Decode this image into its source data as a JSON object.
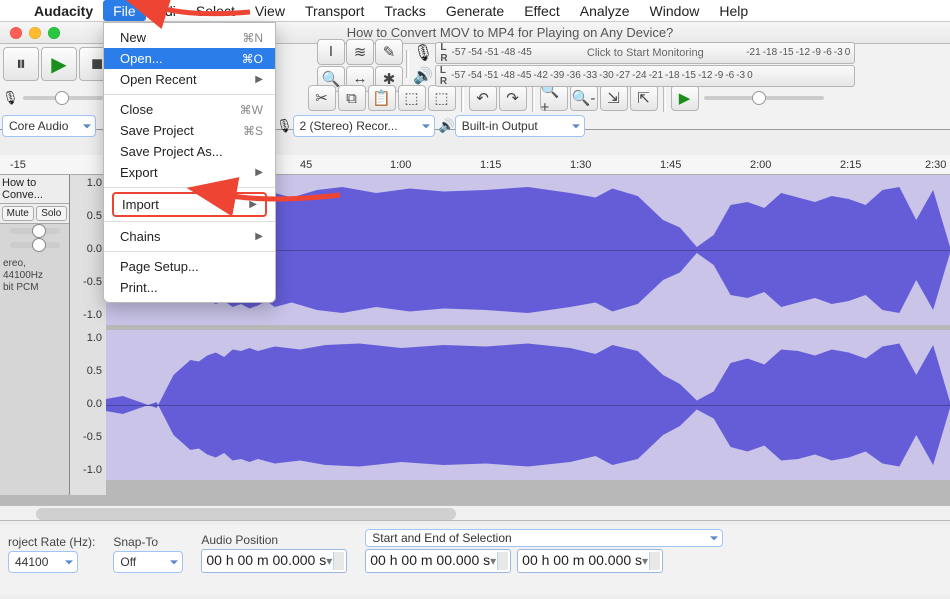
{
  "menubar": {
    "app": "Audacity",
    "items": {
      "file": "File",
      "edit": "Edi",
      "select": "Select",
      "view": "View",
      "transport": "Transport",
      "tracks": "Tracks",
      "generate": "Generate",
      "effect": "Effect",
      "analyze": "Analyze",
      "window": "Window",
      "help": "Help"
    }
  },
  "window": {
    "title": "How to Convert MOV to MP4 for Playing on Any Device?"
  },
  "fileMenu": {
    "new": "New",
    "new_sc": "⌘N",
    "open": "Open...",
    "open_sc": "⌘O",
    "openRecent": "Open Recent",
    "close": "Close",
    "close_sc": "⌘W",
    "saveProject": "Save Project",
    "save_sc": "⌘S",
    "saveProjectAs": "Save Project As...",
    "export": "Export",
    "import": "Import",
    "chains": "Chains",
    "pageSetup": "Page Setup...",
    "print": "Print..."
  },
  "meters": {
    "rec_ticks": [
      "-57",
      "-54",
      "-51",
      "-48",
      "-45"
    ],
    "rec_placeholder": "Click to Start Monitoring",
    "rec_ticks2": [
      "-21",
      "-18",
      "-15",
      "-12",
      "-9",
      "-6",
      "-3",
      "0"
    ],
    "play_ticks": [
      "-57",
      "-54",
      "-51",
      "-48",
      "-45",
      "-42",
      "-39",
      "-36",
      "-33",
      "-30",
      "-27",
      "-24",
      "-21",
      "-18",
      "-15",
      "-12",
      "-9",
      "-6",
      "-3",
      "0"
    ]
  },
  "deviceBar": {
    "host": "Core Audio",
    "recDev": "2 (Stereo) Recor...",
    "playDev": "Built-in Output"
  },
  "ruler": {
    "ticks": [
      "-15",
      "45",
      "1:00",
      "1:15",
      "1:30",
      "1:45",
      "2:00",
      "2:15",
      "2:30"
    ]
  },
  "trackPanel": {
    "name": "How to Conve...",
    "mute": "Mute",
    "solo": "Solo",
    "info1": "ereo, 44100Hz",
    "info2": "bit PCM"
  },
  "dbscale": {
    "v": [
      "1.0",
      "0.5",
      "0.0",
      "-0.5",
      "-1.0"
    ]
  },
  "bottom": {
    "rateLabel": "roject Rate (Hz):",
    "rateVal": "44100",
    "snapLabel": "Snap-To",
    "snapVal": "Off",
    "audioPosLabel": "Audio Position",
    "audioPos": "00 h 00 m 00.000 s",
    "selLabel": "Start and End of Selection",
    "selStart": "00 h 00 m 00.000 s",
    "selEnd": "00 h 00 m 00.000 s"
  }
}
